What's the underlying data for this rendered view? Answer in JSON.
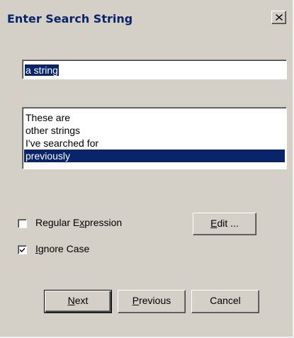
{
  "window": {
    "title": "Enter Search String",
    "close_glyph": "close-icon"
  },
  "search": {
    "value": "a string"
  },
  "history": {
    "items": [
      "These are",
      "other strings",
      "I've searched for",
      "previously"
    ],
    "selected_index": 3
  },
  "options": {
    "regex": {
      "label_pre": "Regular E",
      "label_mnemonic": "x",
      "label_post": "pression",
      "checked": false
    },
    "ignore_case": {
      "label_pre": "",
      "label_mnemonic": "I",
      "label_post": "gnore Case",
      "checked": true
    }
  },
  "buttons": {
    "edit": {
      "mnemonic": "E",
      "rest": "dit ..."
    },
    "next": {
      "mnemonic": "N",
      "rest": "ext"
    },
    "previous": {
      "mnemonic": "P",
      "rest": "revious"
    },
    "cancel": {
      "label": "Cancel"
    }
  },
  "colors": {
    "face": "#d4d0c8",
    "title_text": "#0a246a",
    "selection": "#0a246a"
  }
}
